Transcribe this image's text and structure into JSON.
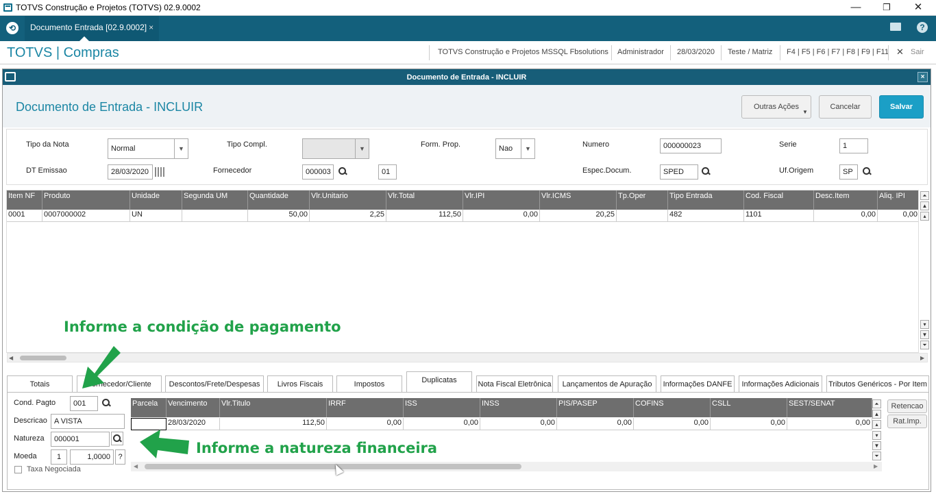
{
  "window": {
    "title": "TOTVS Construção e Projetos (TOTVS) 02.9.0002",
    "min": "—",
    "max": "❐",
    "close": "✕"
  },
  "topbar": {
    "tab_label": "Documento Entrada [02.9.0002]",
    "tab_close": "×",
    "logo": "⟲",
    "help": "?"
  },
  "header": {
    "brand": "TOTVS | Compras",
    "company": "TOTVS Construção e Projetos MSSQL Fbsolutions",
    "user": "Administrador",
    "date": "28/03/2020",
    "branch": "Teste / Matriz",
    "shortcuts": "F4 | F5 | F6 | F7 | F8 | F9 | F11",
    "exit_icon": "✕",
    "exit": "Sair"
  },
  "dialog": {
    "title": "Documento de Entrada - INCLUIR",
    "close": "×",
    "page_title": "Documento de Entrada - INCLUIR",
    "buttons": {
      "other": "Outras Ações",
      "cancel": "Cancelar",
      "save": "Salvar"
    }
  },
  "form": {
    "tipo_nota": {
      "label": "Tipo da Nota",
      "value": "Normal"
    },
    "tipo_compl": {
      "label": "Tipo Compl.",
      "value": ""
    },
    "form_prop": {
      "label": "Form. Prop.",
      "value": "Nao"
    },
    "numero": {
      "label": "Numero",
      "value": "000000023"
    },
    "serie": {
      "label": "Serie",
      "value": "1"
    },
    "dt_emissao": {
      "label": "DT Emissao",
      "value": "28/03/2020"
    },
    "fornecedor": {
      "label": "Fornecedor",
      "value": "000003",
      "loja": "01"
    },
    "espec_docum": {
      "label": "Espec.Docum.",
      "value": "SPED"
    },
    "uf_origem": {
      "label": "Uf.Origem",
      "value": "SP"
    }
  },
  "items_grid": {
    "columns": [
      "Item NF",
      "Produto",
      "Unidade",
      "Segunda UM",
      "Quantidade",
      "Vlr.Unitario",
      "Vlr.Total",
      "Vlr.IPI",
      "Vlr.ICMS",
      "Tp.Oper",
      "Tipo Entrada",
      "Cod. Fiscal",
      "Desc.Item",
      "Aliq. IPI"
    ],
    "rows": [
      [
        "0001",
        "0007000002",
        "UN",
        "",
        "50,00",
        "2,25",
        "112,50",
        "0,00",
        "20,25",
        "",
        "482",
        "1101",
        "0,00",
        "0,00"
      ]
    ]
  },
  "footer_tabs": [
    "Totais",
    "Fornecedor/Cliente",
    "Descontos/Frete/Despesas",
    "Livros Fiscais",
    "Impostos",
    "Duplicatas",
    "Nota Fiscal Eletrônica",
    "Lançamentos de Apuração",
    "Informações DANFE",
    "Informações Adicionais",
    "Tributos Genéricos - Por Item"
  ],
  "payment": {
    "cond_pagto": {
      "label": "Cond. Pagto",
      "value": "001"
    },
    "descricao": {
      "label": "Descricao",
      "value": "A VISTA"
    },
    "natureza": {
      "label": "Natureza",
      "value": "000001"
    },
    "moeda": {
      "label": "Moeda",
      "value": "1",
      "rate": "1,0000",
      "help": "?"
    },
    "taxa_negociada": {
      "label": "Taxa Negociada",
      "checked": false
    }
  },
  "dup_grid": {
    "columns": [
      "Parcela",
      "Vencimento",
      "Vlr.Titulo",
      "IRRF",
      "ISS",
      "INSS",
      "PIS/PASEP",
      "COFINS",
      "CSLL",
      "SEST/SENAT"
    ],
    "rows": [
      [
        "",
        "28/03/2020",
        "112,50",
        "0,00",
        "0,00",
        "0,00",
        "0,00",
        "0,00",
        "0,00",
        "0,00"
      ]
    ]
  },
  "side_buttons": {
    "retencao": "Retencao",
    "rat_imp": "Rat.Imp."
  },
  "annotations": {
    "cond": "Informe a condição de pagamento",
    "natureza": "Informe a natureza financeira"
  },
  "colors": {
    "primary": "#13607c",
    "accent": "#1b86a4",
    "annotation": "#21a24a"
  }
}
